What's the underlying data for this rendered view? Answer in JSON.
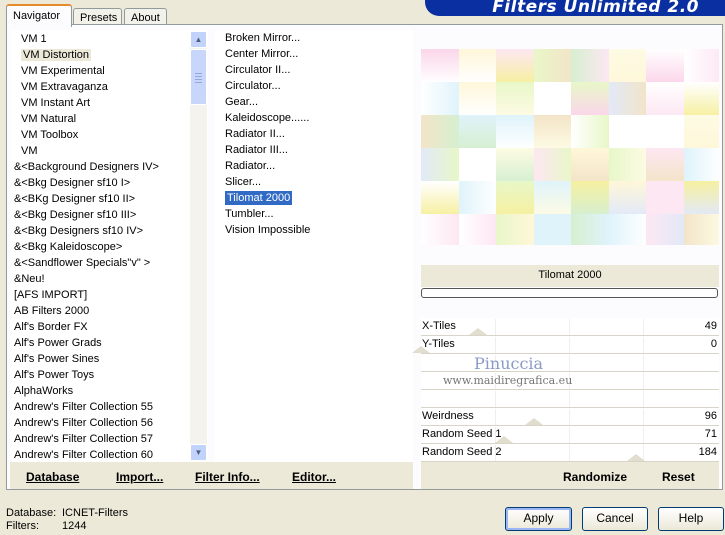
{
  "tabs": [
    "Navigator",
    "Presets",
    "About"
  ],
  "app_title": "Filters Unlimited 2.0",
  "categories": [
    {
      "label": "VM 1",
      "indent": true,
      "selected": false
    },
    {
      "label": "VM Distortion",
      "indent": true,
      "selected": true
    },
    {
      "label": "VM Experimental",
      "indent": true,
      "selected": false
    },
    {
      "label": "VM Extravaganza",
      "indent": true,
      "selected": false
    },
    {
      "label": "VM Instant Art",
      "indent": true,
      "selected": false
    },
    {
      "label": "VM Natural",
      "indent": true,
      "selected": false
    },
    {
      "label": "VM Toolbox",
      "indent": true,
      "selected": false
    },
    {
      "label": "VM",
      "indent": true,
      "selected": false
    },
    {
      "label": "&<Background Designers IV>",
      "indent": false,
      "selected": false
    },
    {
      "label": "&<Bkg Designer sf10 I>",
      "indent": false,
      "selected": false
    },
    {
      "label": "&<BKg Designer sf10 II>",
      "indent": false,
      "selected": false
    },
    {
      "label": "&<Bkg Designer sf10 III>",
      "indent": false,
      "selected": false
    },
    {
      "label": "&<Bkg Designers sf10 IV>",
      "indent": false,
      "selected": false
    },
    {
      "label": "&<Bkg Kaleidoscope>",
      "indent": false,
      "selected": false
    },
    {
      "label": "&<Sandflower Specials\"v\" >",
      "indent": false,
      "selected": false
    },
    {
      "label": "&Neu!",
      "indent": false,
      "selected": false
    },
    {
      "label": "[AFS IMPORT]",
      "indent": false,
      "selected": false
    },
    {
      "label": "AB Filters 2000",
      "indent": false,
      "selected": false
    },
    {
      "label": "Alf's Border FX",
      "indent": false,
      "selected": false
    },
    {
      "label": "Alf's Power Grads",
      "indent": false,
      "selected": false
    },
    {
      "label": "Alf's Power Sines",
      "indent": false,
      "selected": false
    },
    {
      "label": "Alf's Power Toys",
      "indent": false,
      "selected": false
    },
    {
      "label": "AlphaWorks",
      "indent": false,
      "selected": false
    },
    {
      "label": "Andrew's Filter Collection 55",
      "indent": false,
      "selected": false
    },
    {
      "label": "Andrew's Filter Collection 56",
      "indent": false,
      "selected": false
    },
    {
      "label": "Andrew's Filter Collection 57",
      "indent": false,
      "selected": false
    },
    {
      "label": "Andrew's Filter Collection 60",
      "indent": false,
      "selected": false
    }
  ],
  "filters": [
    {
      "label": "Broken Mirror...",
      "selected": false
    },
    {
      "label": "Center Mirror...",
      "selected": false
    },
    {
      "label": "Circulator II...",
      "selected": false
    },
    {
      "label": "Circulator...",
      "selected": false
    },
    {
      "label": "Gear...",
      "selected": false
    },
    {
      "label": "Kaleidoscope......",
      "selected": false
    },
    {
      "label": "Radiator II...",
      "selected": false
    },
    {
      "label": "Radiator III...",
      "selected": false
    },
    {
      "label": "Radiator...",
      "selected": false
    },
    {
      "label": "Slicer...",
      "selected": false
    },
    {
      "label": "Tilomat 2000",
      "selected": true
    },
    {
      "label": "Tumbler...",
      "selected": false
    },
    {
      "label": "Vision Impossible",
      "selected": false
    }
  ],
  "bottom_links": {
    "database": "Database",
    "import": "Import...",
    "filter_info": "Filter Info...",
    "editor": "Editor..."
  },
  "preview_filter_name": "Tilomat 2000",
  "params": [
    {
      "label": "X-Tiles",
      "value": "49"
    },
    {
      "label": "Y-Tiles",
      "value": "0"
    },
    {
      "label": "",
      "value": ""
    },
    {
      "label": "",
      "value": ""
    },
    {
      "label": "",
      "value": ""
    },
    {
      "label": "Weirdness",
      "value": "96"
    },
    {
      "label": "Random Seed 1",
      "value": "71"
    },
    {
      "label": "Random Seed 2",
      "value": "184"
    }
  ],
  "param_levels": [
    0.19,
    0,
    null,
    null,
    null,
    0.38,
    0.28,
    0.72
  ],
  "watermark": {
    "name": "Pinuccia",
    "url": "www.maidiregrafica.eu"
  },
  "actions": {
    "randomize": "Randomize",
    "reset": "Reset"
  },
  "status": {
    "database_label": "Database:",
    "database_value": "ICNET-Filters",
    "filters_label": "Filters:",
    "filters_value": "1244"
  },
  "buttons": {
    "apply": "Apply",
    "cancel": "Cancel",
    "help": "Help"
  },
  "colors": {
    "selection": "#316ac5",
    "title_banner": "#0a2fa0",
    "tab_highlight": "#e68b2c"
  },
  "icons": {
    "scroll_up": "scroll-up-arrow-icon",
    "scroll_down": "scroll-down-arrow-icon"
  }
}
